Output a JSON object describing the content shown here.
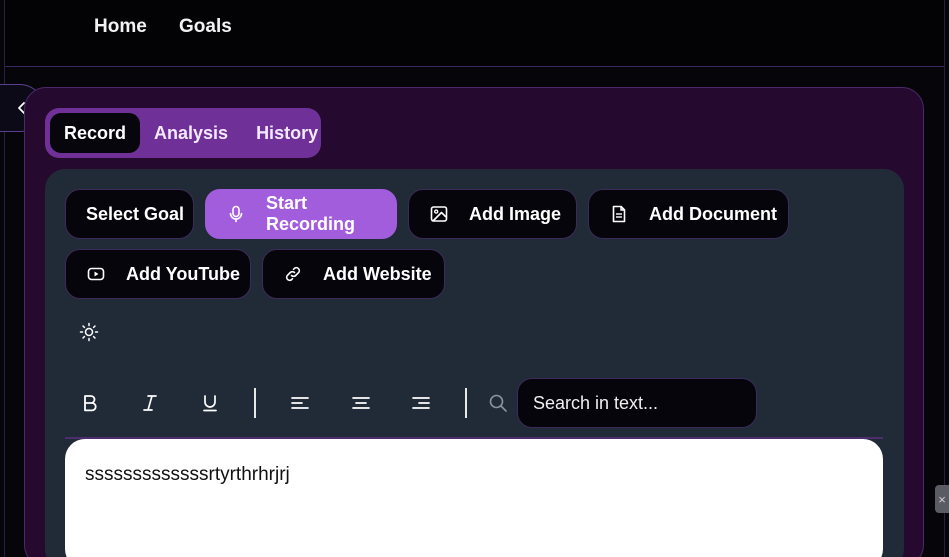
{
  "nav": {
    "home": "Home",
    "goals": "Goals"
  },
  "tabs": [
    {
      "label": "Record",
      "active": true
    },
    {
      "label": "Analysis",
      "active": false
    },
    {
      "label": "History",
      "active": false
    }
  ],
  "actions": {
    "select_goal": "Select Goal",
    "start_recording": "Start Recording",
    "add_image": "Add Image",
    "add_document": "Add Document",
    "add_youtube": "Add YouTube",
    "add_website": "Add Website"
  },
  "toolbar": {
    "bold": "B",
    "italic": "I",
    "underline": "U",
    "search_placeholder": "Search in text..."
  },
  "editor": {
    "content": "sssssssssssssrtyrthrhrjrj"
  },
  "colors": {
    "accent": "#a25ddc",
    "tab_bar": "#6f3198",
    "panel": "#25092f",
    "card": "#212a37"
  }
}
